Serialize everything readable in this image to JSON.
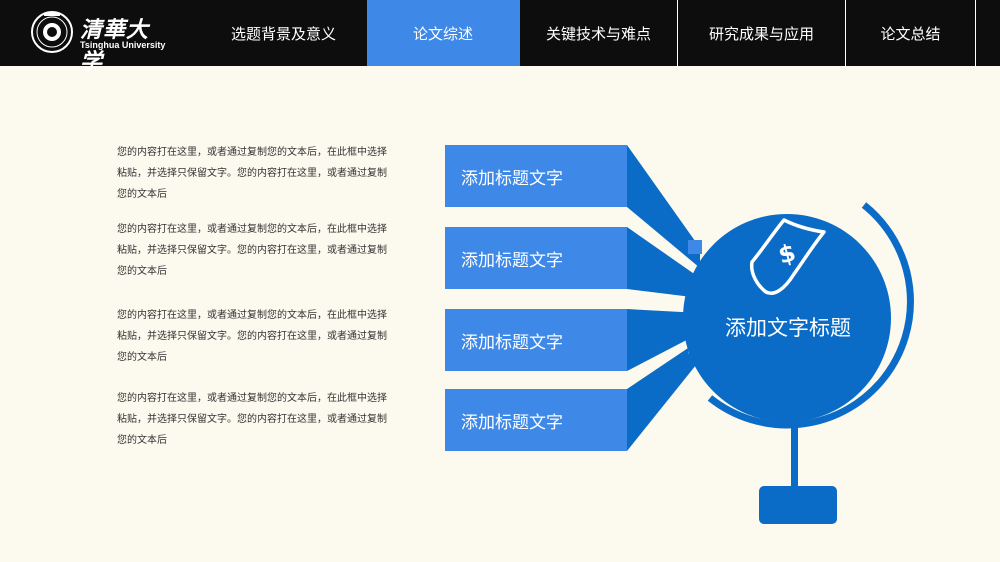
{
  "header": {
    "logo_cn": "清華大学",
    "logo_en": "Tsinghua University",
    "tabs": [
      {
        "label": "选题背景及意义",
        "active": false
      },
      {
        "label": "论文综述",
        "active": true
      },
      {
        "label": "关键技术与难点",
        "active": false
      },
      {
        "label": "研究成果与应用",
        "active": false
      },
      {
        "label": "论文总结",
        "active": false
      }
    ]
  },
  "main": {
    "paragraphs": [
      "您的内容打在这里，或者通过复制您的文本后，在此框中选择粘贴，并选择只保留文字。您的内容打在这里，或者通过复制您的文本后",
      "您的内容打在这里，或者通过复制您的文本后，在此框中选择粘贴，并选择只保留文字。您的内容打在这里，或者通过复制您的文本后",
      "您的内容打在这里，或者通过复制您的文本后，在此框中选择粘贴，并选择只保留文字。您的内容打在这里，或者通过复制您的文本后",
      "您的内容打在这里，或者通过复制您的文本后，在此框中选择粘贴，并选择只保留文字。您的内容打在这里，或者通过复制您的文本后"
    ],
    "title_boxes": [
      "添加标题文字",
      "添加标题文字",
      "添加标题文字",
      "添加标题文字"
    ],
    "center_title": "添加文字标题",
    "center_icon": "money-bill-icon"
  },
  "colors": {
    "background": "#fcf9ee",
    "header": "#0d0d0d",
    "accent": "#3e89e8",
    "dark_blue": "#0b6cc7"
  }
}
